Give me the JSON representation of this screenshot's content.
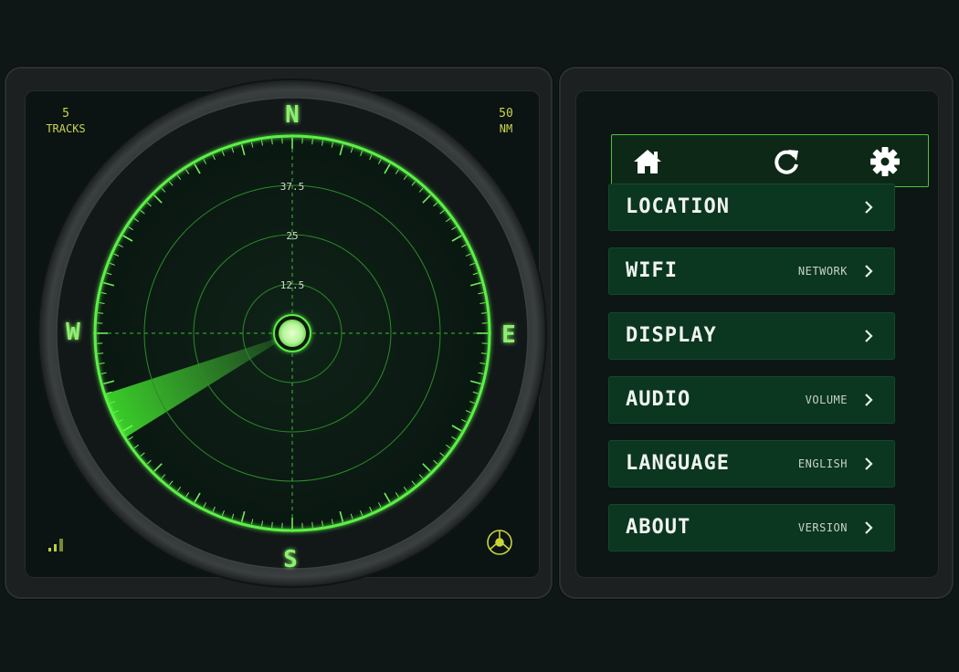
{
  "radar": {
    "tracks_count": "5",
    "tracks_label": "TRACKS",
    "range_value": "50",
    "range_unit": "NM",
    "compass": {
      "north": "N",
      "south": "S",
      "east": "E",
      "west": "W"
    },
    "ring_labels": [
      "12.5",
      "25",
      "37.5"
    ],
    "sweep_bearing_deg": 245,
    "accent_color": "#5cf046",
    "signal_icon": "signal-bars-icon",
    "target_icon": "crosshair-target-icon"
  },
  "toolbar": {
    "home_icon": "home-icon",
    "refresh_icon": "refresh-icon",
    "settings_icon": "gear-icon"
  },
  "menu": {
    "items": [
      {
        "label": "LOCATION",
        "sub": ""
      },
      {
        "label": "WIFI",
        "sub": "NETWORK"
      },
      {
        "label": "DISPLAY",
        "sub": ""
      },
      {
        "label": "AUDIO",
        "sub": "VOLUME"
      },
      {
        "label": "LANGUAGE",
        "sub": "ENGLISH"
      },
      {
        "label": "ABOUT",
        "sub": "VERSION"
      }
    ]
  }
}
